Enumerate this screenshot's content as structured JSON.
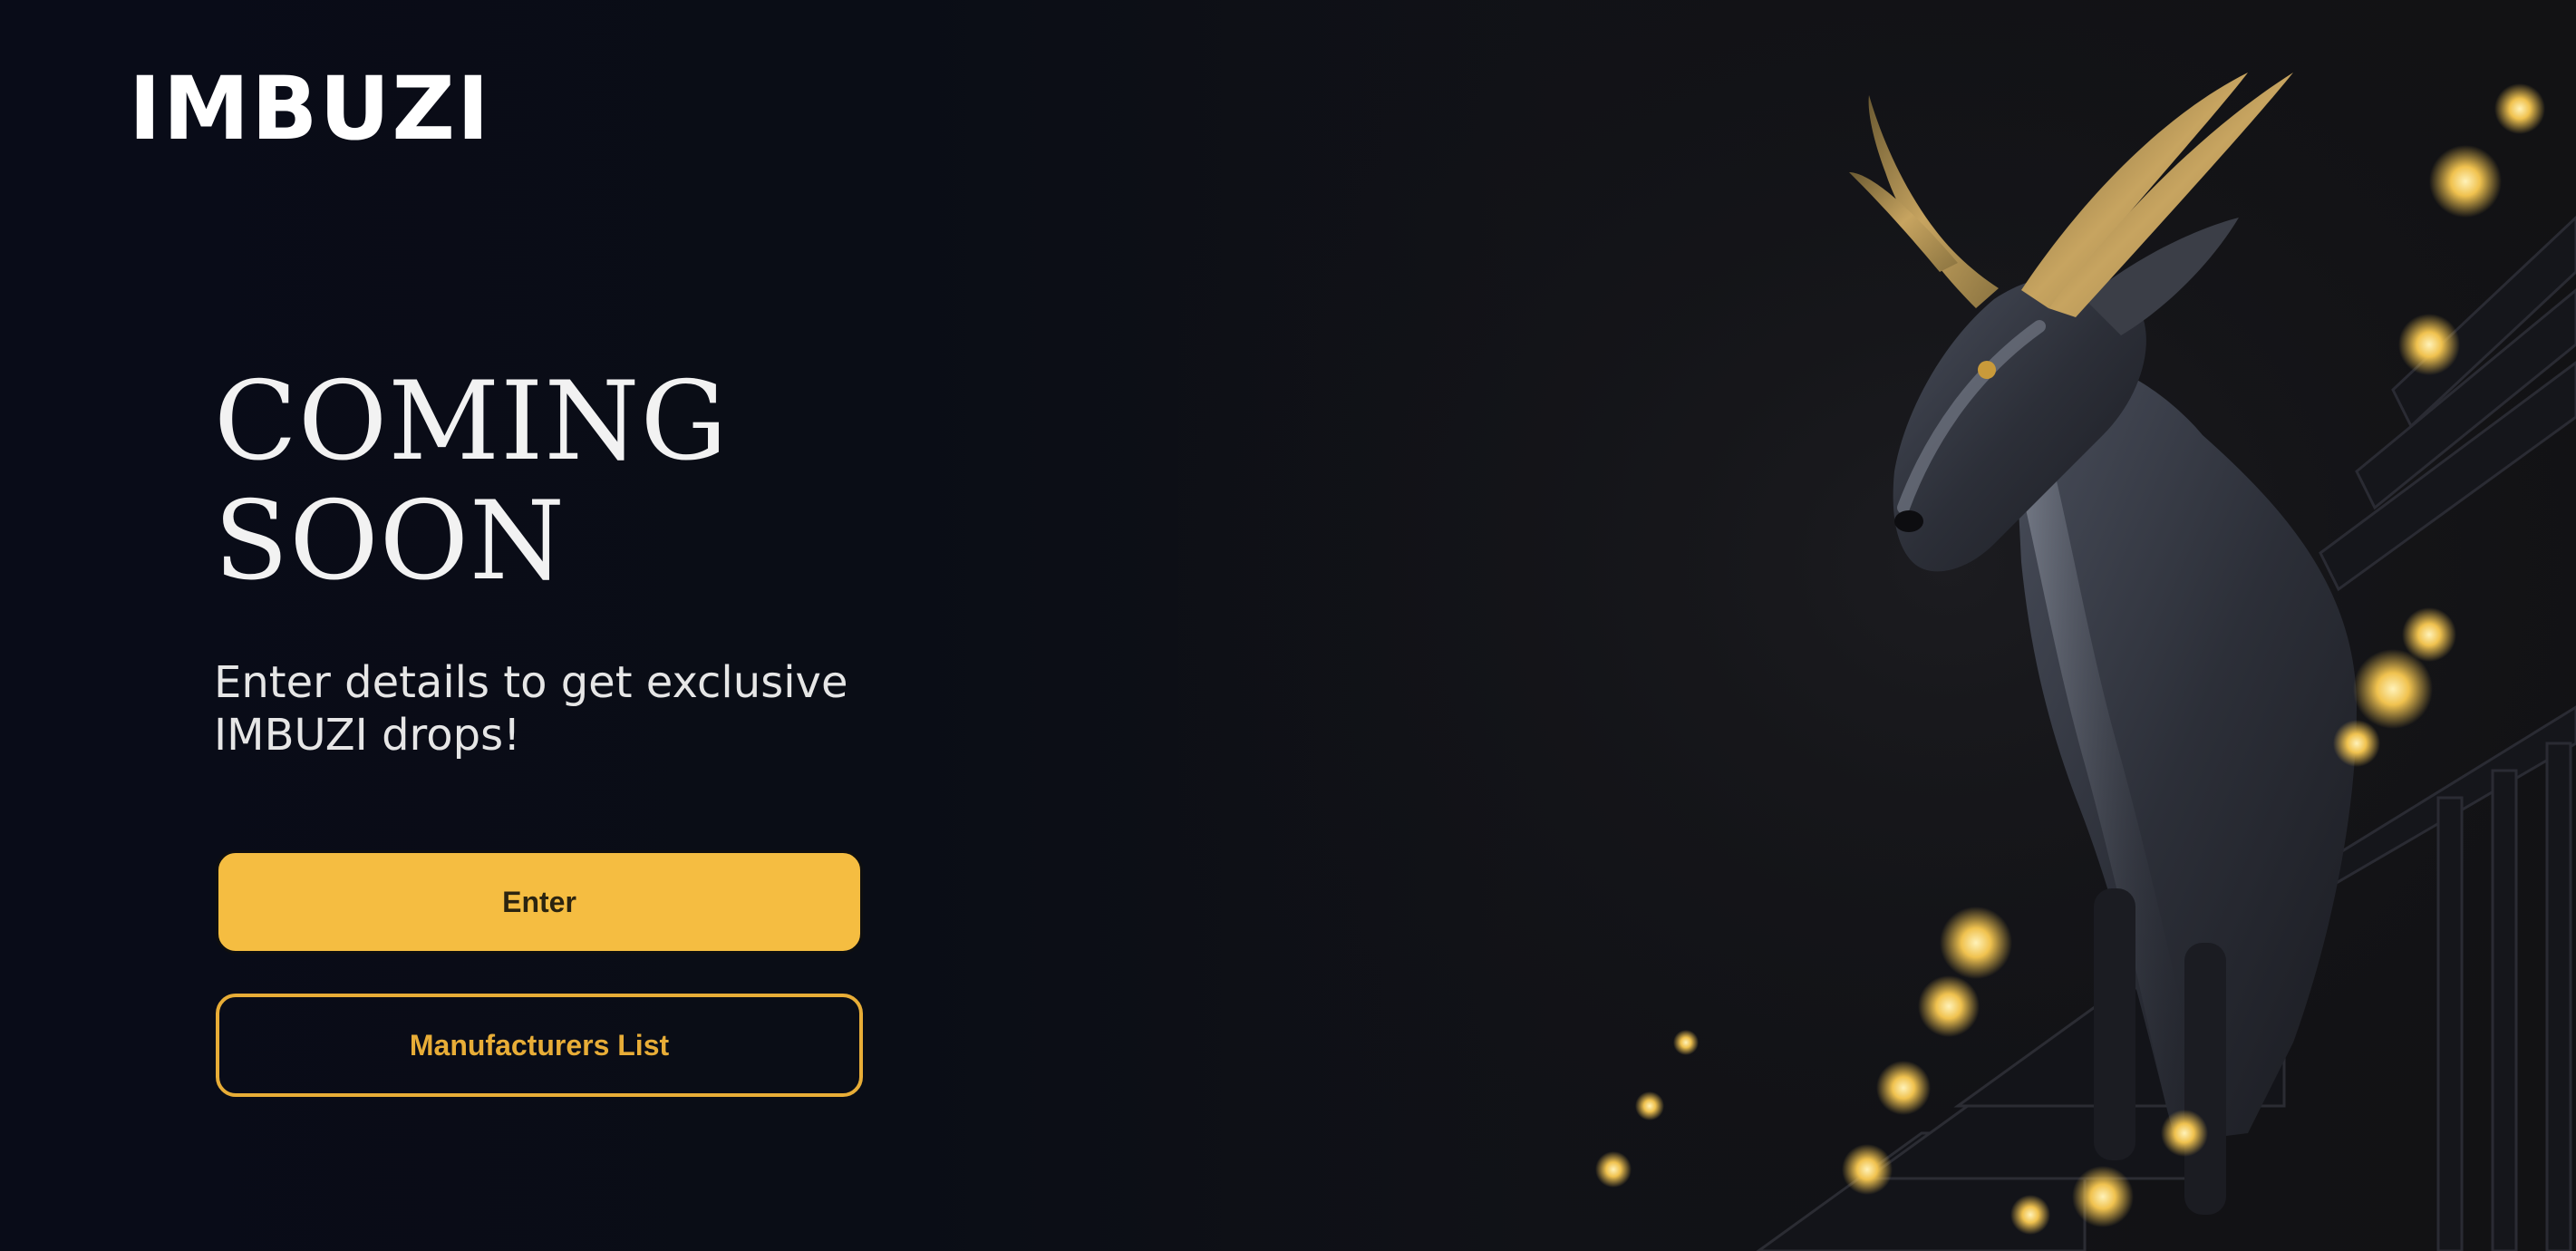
{
  "brand": {
    "logo_text": "IMBUZI"
  },
  "hero": {
    "headline_line1": "COMING",
    "headline_line2": "SOON",
    "subtitle_line1": "Enter details to get exclusive",
    "subtitle_line2": "IMBUZI drops!"
  },
  "actions": {
    "enter_label": "Enter",
    "manufacturers_label": "Manufacturers List"
  },
  "colors": {
    "background": "#0a0d16",
    "accent": "#f5bd41",
    "text": "#ffffff"
  },
  "art": {
    "subject": "goat-on-staircase-illustration"
  }
}
